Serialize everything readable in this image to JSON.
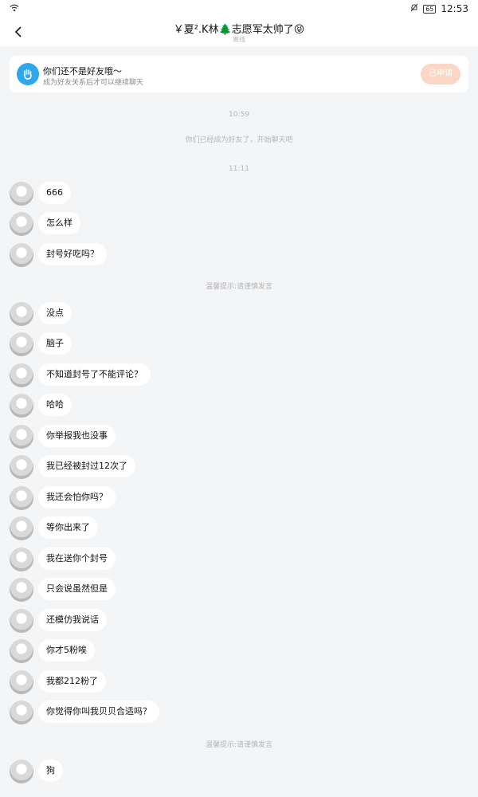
{
  "status": {
    "battery": "65",
    "time": "12:53"
  },
  "nav": {
    "title": "￥夏².K林🌲志愿军太帅了😝",
    "subtitle": "离线"
  },
  "banner": {
    "title": "你们还不是好友哦～",
    "subtitle": "成为好友关系后才可以继续聊天",
    "button": "已申请"
  },
  "notes": {
    "time1": "10:59",
    "friend": "你们已经成为好友了，开始聊天吧",
    "time2": "11:11",
    "warn1": "温馨提示:请谨慎发言",
    "warn2": "温馨提示:请谨慎发言"
  },
  "messages": [
    "666",
    "怎么样",
    "封号好吃吗？",
    "没点",
    "脑子",
    "不知道封号了不能评论？",
    "哈哈",
    "你举报我也没事",
    "我已经被封过12次了",
    "我还会怕你吗？",
    "等你出来了",
    "我在送你个封号",
    "只会说虽然但是",
    "还模仿我说话",
    "你才5粉唉",
    "我都212粉了",
    "你觉得你叫我贝贝合适吗？",
    "狗"
  ],
  "colors": {
    "accent": "#2ea7ef",
    "apply_button": "#fcd7c6",
    "page_bg": "#f4f5f7"
  }
}
